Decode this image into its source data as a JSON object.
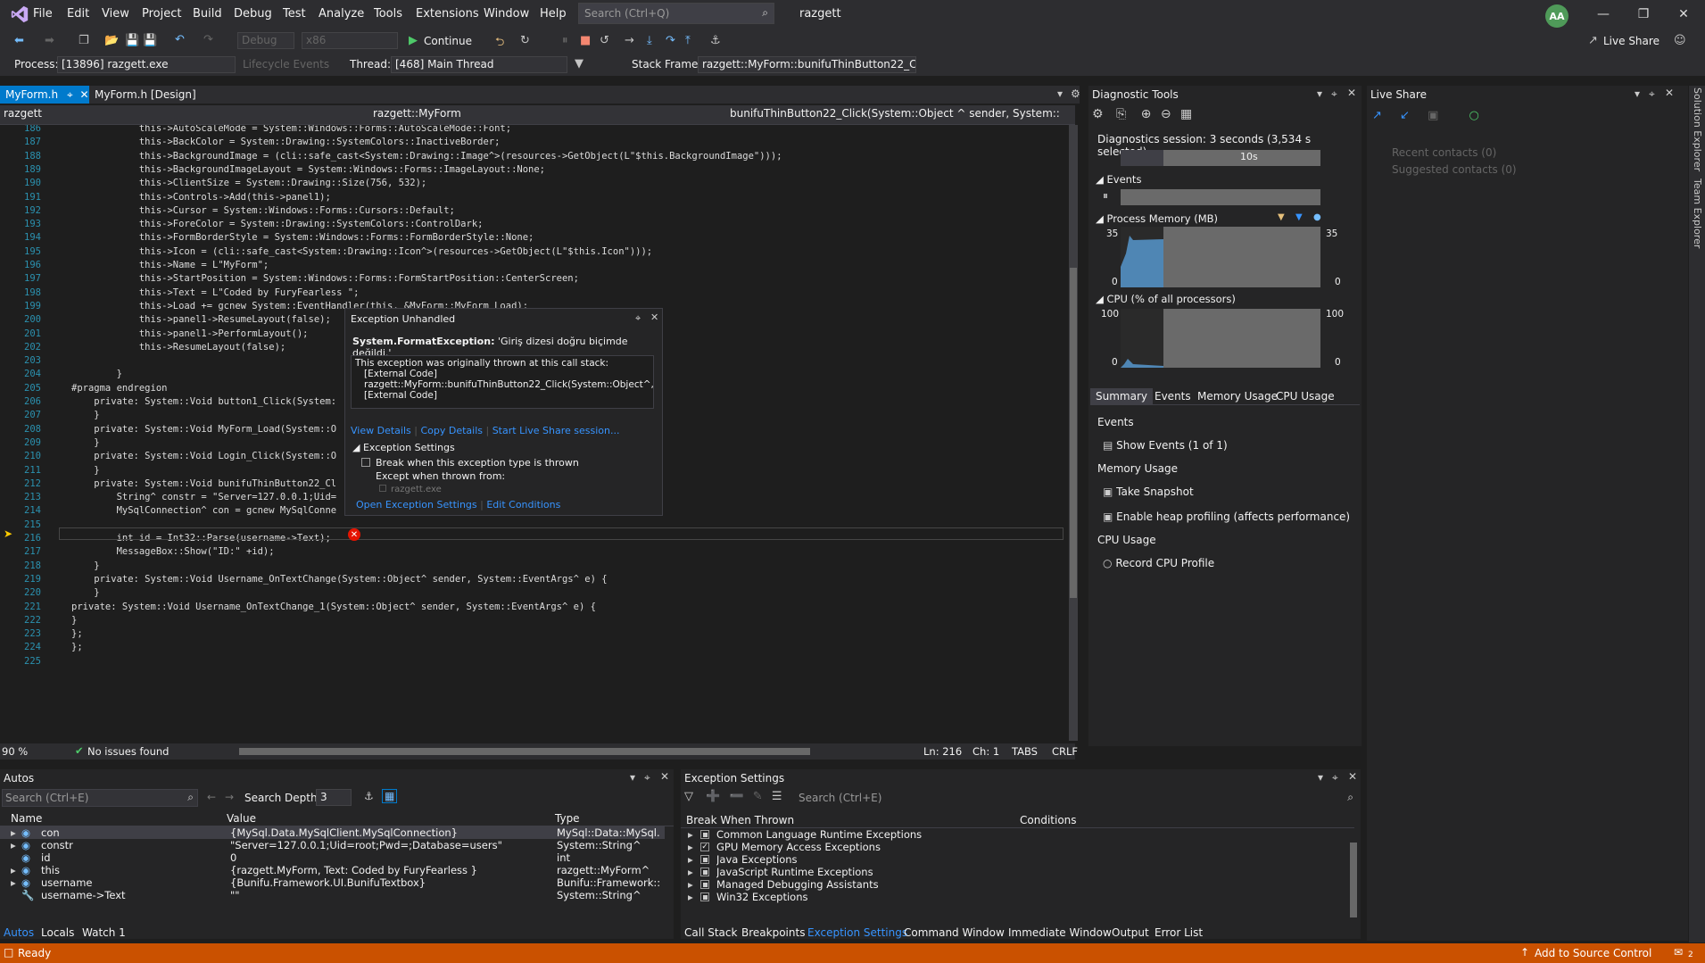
{
  "titlebar": {
    "menus": [
      "File",
      "Edit",
      "View",
      "Project",
      "Build",
      "Debug",
      "Test",
      "Analyze",
      "Tools",
      "Extensions",
      "Window",
      "Help"
    ],
    "search_placeholder": "Search (Ctrl+Q)",
    "solution": "razgett",
    "avatar": "AA",
    "live_share": "Live Share"
  },
  "toolbar": {
    "config": "Debug",
    "platform": "x86",
    "continue": "Continue",
    "process_label": "Process:",
    "process": "[13896] razgett.exe",
    "lifecycle": "Lifecycle Events",
    "thread_label": "Thread:",
    "thread": "[468] Main Thread",
    "stack_label": "Stack Frame:",
    "stack": "razgett::MyForm::bunifuThinButton22_Cli"
  },
  "editor": {
    "tabs": [
      "MyForm.h",
      "MyForm.h [Design]"
    ],
    "nav": [
      "razgett",
      "razgett::MyForm",
      "bunifuThinButton22_Click(System::Object ^ sender, System::EventAr"
    ],
    "zoom": "90 %",
    "issues": "No issues found",
    "position": {
      "ln": "Ln: 216",
      "ch": "Ch: 1",
      "tabs": "TABS",
      "eol": "CRLF"
    },
    "lines": [
      {
        "n": "186",
        "t": "            this->AutoScaleMode = System::Windows::Forms::AutoScaleMode::Font;"
      },
      {
        "n": "187",
        "t": "            this->BackColor = System::Drawing::SystemColors::InactiveBorder;"
      },
      {
        "n": "188",
        "t": "            this->BackgroundImage = (cli::safe_cast<System::Drawing::Image^>(resources->GetObject(L\"$this.BackgroundImage\")));"
      },
      {
        "n": "189",
        "t": "            this->BackgroundImageLayout = System::Windows::Forms::ImageLayout::None;"
      },
      {
        "n": "190",
        "t": "            this->ClientSize = System::Drawing::Size(756, 532);"
      },
      {
        "n": "191",
        "t": "            this->Controls->Add(this->panel1);"
      },
      {
        "n": "192",
        "t": "            this->Cursor = System::Windows::Forms::Cursors::Default;"
      },
      {
        "n": "193",
        "t": "            this->ForeColor = System::Drawing::SystemColors::ControlDark;"
      },
      {
        "n": "194",
        "t": "            this->FormBorderStyle = System::Windows::Forms::FormBorderStyle::None;"
      },
      {
        "n": "195",
        "t": "            this->Icon = (cli::safe_cast<System::Drawing::Icon^>(resources->GetObject(L\"$this.Icon\")));"
      },
      {
        "n": "196",
        "t": "            this->Name = L\"MyForm\";"
      },
      {
        "n": "197",
        "t": "            this->StartPosition = System::Windows::Forms::FormStartPosition::CenterScreen;"
      },
      {
        "n": "198",
        "t": "            this->Text = L\"Coded by FuryFearless \";"
      },
      {
        "n": "199",
        "t": "            this->Load += gcnew System::EventHandler(this, &MyForm::MyForm_Load);"
      },
      {
        "n": "200",
        "t": "            this->panel1->ResumeLayout(false);"
      },
      {
        "n": "201",
        "t": "            this->panel1->PerformLayout();"
      },
      {
        "n": "202",
        "t": "            this->ResumeLayout(false);"
      },
      {
        "n": "203",
        "t": ""
      },
      {
        "n": "204",
        "t": "        }"
      },
      {
        "n": "205",
        "t": "#pragma endregion"
      },
      {
        "n": "206",
        "t": "    private: System::Void button1_Click(System:"
      },
      {
        "n": "207",
        "t": "    }"
      },
      {
        "n": "208",
        "t": "    private: System::Void MyForm_Load(System::O"
      },
      {
        "n": "209",
        "t": "    }"
      },
      {
        "n": "210",
        "t": "    private: System::Void Login_Click(System::O"
      },
      {
        "n": "211",
        "t": "    }"
      },
      {
        "n": "212",
        "t": "    private: System::Void bunifuThinButton22_Cl"
      },
      {
        "n": "213",
        "t": "        String^ constr = \"Server=127.0.0.1;Uid="
      },
      {
        "n": "214",
        "t": "        MySqlConnection^ con = gcnew MySqlConne"
      },
      {
        "n": "215",
        "t": ""
      },
      {
        "n": "216",
        "t": "        int id = Int32::Parse(username->Text);"
      },
      {
        "n": "217",
        "t": "        MessageBox::Show(\"ID:\" +id);"
      },
      {
        "n": "218",
        "t": "    }"
      },
      {
        "n": "219",
        "t": "    private: System::Void Username_OnTextChange(System::Object^ sender, System::EventArgs^ e) {"
      },
      {
        "n": "220",
        "t": "    }"
      },
      {
        "n": "221",
        "t": "private: System::Void Username_OnTextChange_1(System::Object^ sender, System::EventArgs^ e) {"
      },
      {
        "n": "222",
        "t": "}"
      },
      {
        "n": "223",
        "t": "};"
      },
      {
        "n": "224",
        "t": "};"
      },
      {
        "n": "225",
        "t": ""
      }
    ]
  },
  "exception": {
    "title": "Exception Unhandled",
    "type": "System.FormatException:",
    "message": "'Giriş dizesi doğru biçimde değildi.'",
    "stack_intro": "This exception was originally thrown at this call stack:",
    "stack": [
      "[External Code]",
      "razgett::MyForm::bunifuThinButton22_Click(System::Object^, Syste",
      "[External Code]"
    ],
    "links": [
      "View Details",
      "Copy Details",
      "Start Live Share session..."
    ],
    "settings_title": "Exception Settings",
    "break_label": "Break when this exception type is thrown",
    "except_label": "Except when thrown from:",
    "module": "razgett.exe",
    "footer_links": [
      "Open Exception Settings",
      "Edit Conditions"
    ]
  },
  "diagnostics": {
    "title": "Diagnostic Tools",
    "session": "Diagnostics session: 3 seconds (3,534 s selected)",
    "timeline_label": "10s",
    "events_label": "Events",
    "memory_label": "Process Memory (MB)",
    "memory_max": "35",
    "memory_min": "0",
    "cpu_label": "CPU (% of all processors)",
    "cpu_max": "100",
    "cpu_min": "0",
    "tabs": [
      "Summary",
      "Events",
      "Memory Usage",
      "CPU Usage"
    ],
    "sections": {
      "events_head": "Events",
      "show_events": "Show Events (1 of 1)",
      "mem_head": "Memory Usage",
      "snapshot": "Take Snapshot",
      "heap": "Enable heap profiling (affects performance)",
      "cpu_head": "CPU Usage",
      "record": "Record CPU Profile"
    }
  },
  "liveshare": {
    "title": "Live Share",
    "recent": "Recent contacts (0)",
    "suggested": "Suggested contacts (0)",
    "side_tabs": [
      "Solution Explorer",
      "Team Explorer"
    ]
  },
  "autos": {
    "title": "Autos",
    "search_placeholder": "Search (Ctrl+E)",
    "depth_label": "Search Depth:",
    "depth": "3",
    "columns": [
      "Name",
      "Value",
      "Type"
    ],
    "rows": [
      {
        "name": "con",
        "value": "{MySql.Data.MySqlClient.MySqlConnection}",
        "type": "MySql::Data::MySql..."
      },
      {
        "name": "constr",
        "value": "\"Server=127.0.0.1;Uid=root;Pwd=;Database=users\"",
        "type": "System::String^"
      },
      {
        "name": "id",
        "value": "0",
        "type": "int"
      },
      {
        "name": "this",
        "value": "{razgett.MyForm, Text: Coded by FuryFearless }",
        "type": "razgett::MyForm^"
      },
      {
        "name": "username",
        "value": "{Bunifu.Framework.UI.BunifuTextbox}",
        "type": "Bunifu::Framework::..."
      },
      {
        "name": "username->Text",
        "value": "\"\"",
        "type": "System::String^"
      }
    ],
    "tabs": [
      "Autos",
      "Locals",
      "Watch 1"
    ]
  },
  "exception_settings": {
    "title": "Exception Settings",
    "search_placeholder": "Search (Ctrl+E)",
    "columns": [
      "Break When Thrown",
      "Conditions"
    ],
    "rows": [
      {
        "label": "Common Language Runtime Exceptions",
        "checked": "partial"
      },
      {
        "label": "GPU Memory Access Exceptions",
        "checked": "yes"
      },
      {
        "label": "Java Exceptions",
        "checked": "partial"
      },
      {
        "label": "JavaScript Runtime Exceptions",
        "checked": "partial"
      },
      {
        "label": "Managed Debugging Assistants",
        "checked": "partial"
      },
      {
        "label": "Win32 Exceptions",
        "checked": "partial"
      }
    ],
    "tabs": [
      "Call Stack",
      "Breakpoints",
      "Exception Settings",
      "Command Window",
      "Immediate Window",
      "Output",
      "Error List"
    ]
  },
  "status": {
    "ready": "Ready",
    "source_control": "Add to Source Control",
    "notifications": "2"
  },
  "colors": {
    "accent": "#007acc",
    "status": "#ca5100",
    "error": "#e51400"
  }
}
